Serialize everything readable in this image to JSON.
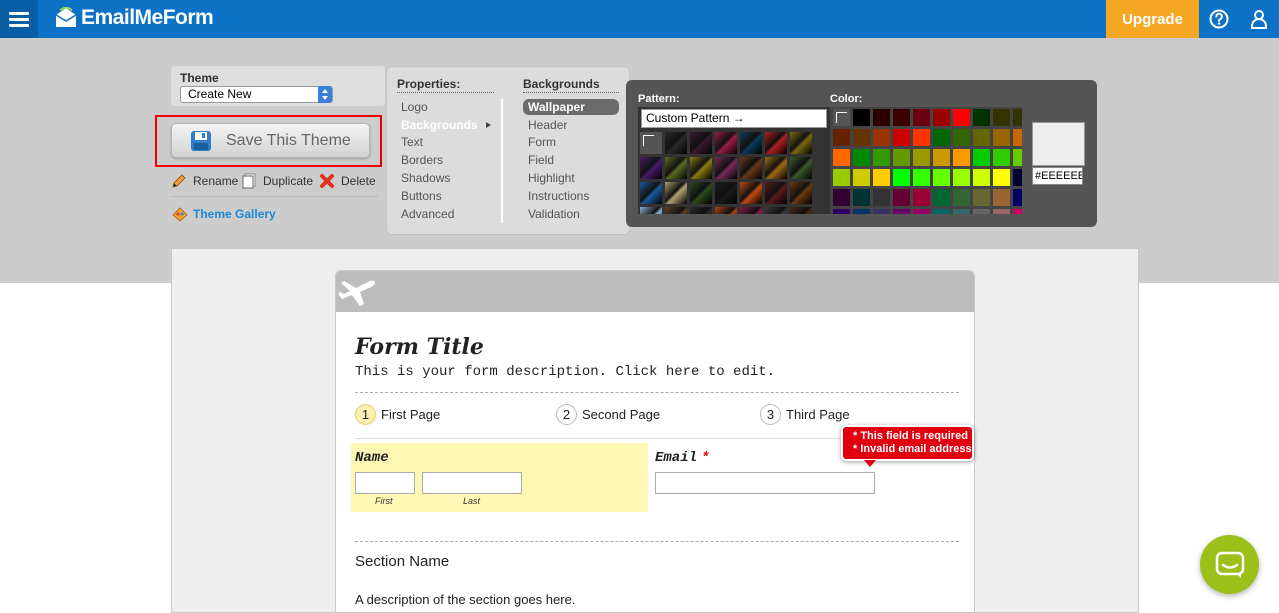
{
  "header": {
    "brand": "EmailMeForm",
    "upgrade_label": "Upgrade",
    "colors": {
      "bar": "#0b72c6",
      "upgrade": "#f5a623"
    },
    "icons": [
      "menu-icon",
      "help-icon",
      "user-icon"
    ]
  },
  "theme": {
    "label": "Theme",
    "selected": "Create New",
    "save_label": "Save This Theme",
    "actions": {
      "rename": "Rename",
      "duplicate": "Duplicate",
      "delete": "Delete"
    },
    "gallery_label": "Theme Gallery"
  },
  "properties": {
    "heading": "Properties:",
    "items": [
      "Logo",
      "Backgrounds",
      "Text",
      "Borders",
      "Shadows",
      "Buttons",
      "Advanced"
    ],
    "active_item": "Backgrounds"
  },
  "backgrounds": {
    "heading": "Backgrounds",
    "items": [
      "Wallpaper",
      "Header",
      "Form",
      "Field",
      "Highlight",
      "Instructions",
      "Validation"
    ],
    "active_item": "Wallpaper"
  },
  "picker": {
    "pattern_label": "Pattern:",
    "color_label": "Color:",
    "custom_pattern": "Custom Pattern →",
    "hex_value": "#EEEEEE",
    "pattern_colors": [
      "#2b2b2b",
      "#3b1a2e",
      "#9c1c4a",
      "#0c3a5a",
      "#b02020",
      "#7a6a10",
      "#4a1a6a",
      "#5a6a20",
      "#8a7a10",
      "#7a2a5a",
      "#6a3a1a",
      "#a06a10",
      "#3a5a2a",
      "#1a5aa0",
      "#b0a070",
      "#2a4a1a",
      "#1a1a1a",
      "#c04a10",
      "#5a1a1a",
      "#6a3a10",
      "#8ab0d0",
      "#5a4020",
      "#2a2a2a",
      "#b04010",
      "#8a1a4a",
      "#3a3a3a",
      "#4a2a1a",
      "#3a4a5a"
    ],
    "swatches": [
      "#000000",
      "#2a0000",
      "#3a0000",
      "#6a0010",
      "#990000",
      "#ff0000",
      "#003300",
      "#333300",
      "#333300",
      "#662200",
      "#663300",
      "#993300",
      "#cc0000",
      "#ff3300",
      "#006600",
      "#336600",
      "#666600",
      "#996600",
      "#cc6600",
      "#ff6600",
      "#008800",
      "#339900",
      "#669900",
      "#999900",
      "#cc9900",
      "#ff9900",
      "#00cc00",
      "#33cc00",
      "#66cc00",
      "#99cc00",
      "#cccc00",
      "#ffcc00",
      "#00ff00",
      "#33ff00",
      "#66ff00",
      "#99ff00",
      "#ccff00",
      "#ffff00",
      "#000033",
      "#330033",
      "#003333",
      "#333333",
      "#660033",
      "#990033",
      "#006633",
      "#336633",
      "#666633",
      "#996633",
      "#000066",
      "#330066",
      "#003366",
      "#333366",
      "#660066",
      "#990066",
      "#006666",
      "#336666",
      "#666666",
      "#996666",
      "#cc0066",
      "#ff0066"
    ],
    "preview_color": "#eeeeee"
  },
  "form": {
    "title": "Form Title",
    "description": "This is your form description. Click here to edit.",
    "pages": [
      {
        "num": "1",
        "label": "First Page"
      },
      {
        "num": "2",
        "label": "Second Page"
      },
      {
        "num": "3",
        "label": "Third Page"
      }
    ],
    "name_label": "Name",
    "first_label": "First",
    "last_label": "Last",
    "email_label": "Email",
    "required_mark": "*",
    "errors": [
      "* This field is required",
      "* Invalid email address"
    ],
    "section_name": "Section Name",
    "section_desc": "A description of the section goes here."
  }
}
